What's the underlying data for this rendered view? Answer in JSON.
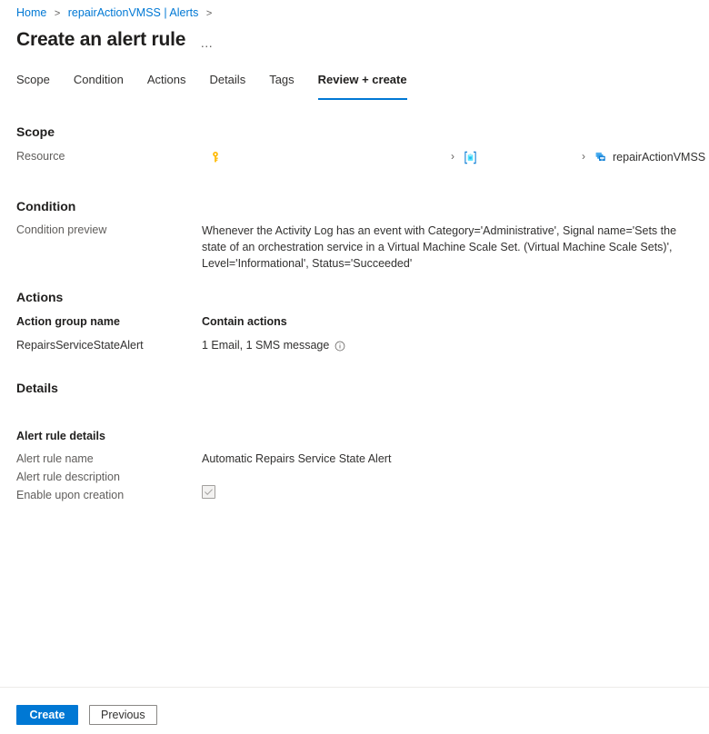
{
  "breadcrumb": {
    "items": [
      "Home",
      "repairActionVMSS | Alerts"
    ],
    "separator": ">"
  },
  "header": {
    "title": "Create an alert rule",
    "more_label": "…"
  },
  "tabs": [
    {
      "label": "Scope",
      "active": false
    },
    {
      "label": "Condition",
      "active": false
    },
    {
      "label": "Actions",
      "active": false
    },
    {
      "label": "Details",
      "active": false
    },
    {
      "label": "Tags",
      "active": false
    },
    {
      "label": "Review + create",
      "active": true
    }
  ],
  "scope": {
    "heading": "Scope",
    "resource_label": "Resource",
    "chain": [
      {
        "icon": "subscription-key-icon",
        "text": ""
      },
      {
        "icon": "resource-group-icon",
        "text": ""
      },
      {
        "icon": "virtual-machine-scale-set-icon",
        "text": "repairActionVMSS"
      }
    ],
    "separator": "›"
  },
  "condition": {
    "heading": "Condition",
    "preview_label": "Condition preview",
    "preview_text": "Whenever the Activity Log has an event with Category='Administrative', Signal name='Sets the state of an orchestration service in a Virtual Machine Scale Set. (Virtual Machine Scale Sets)', Level='Informational', Status='Succeeded'"
  },
  "actions": {
    "heading": "Actions",
    "columns": [
      "Action group name",
      "Contain actions"
    ],
    "rows": [
      {
        "action_group_name": "RepairsServiceStateAlert",
        "contain_actions": "1 Email, 1 SMS message"
      }
    ]
  },
  "details": {
    "heading": "Details",
    "subheading": "Alert rule details",
    "fields": [
      {
        "label": "Alert rule name",
        "value": "Automatic Repairs Service State Alert"
      },
      {
        "label": "Alert rule description",
        "value": ""
      },
      {
        "label": "Enable upon creation",
        "value": "checked"
      }
    ]
  },
  "footer": {
    "create_label": "Create",
    "previous_label": "Previous"
  },
  "colors": {
    "accent": "#0078d4",
    "link": "#0078d4",
    "text": "#323130",
    "muted": "#605e5c",
    "divider": "#edebe9",
    "subscription_icon": "#ffb900",
    "resource_group_icon": "#50e6ff",
    "vmss_icon": "#0078d4"
  }
}
